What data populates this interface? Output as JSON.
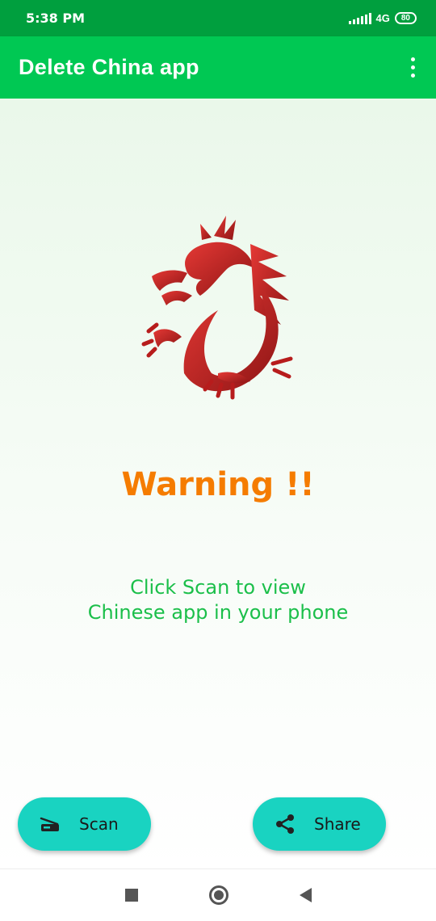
{
  "status_bar": {
    "time": "5:38 PM",
    "network": "4G",
    "battery": "80"
  },
  "app_bar": {
    "title": "Delete China app",
    "menu_icon": "more-vert-icon"
  },
  "main": {
    "image": "red-dragon-image",
    "warning": "Warning !!",
    "hint_line1": "Click Scan to view",
    "hint_line2": "Chinese app in your phone"
  },
  "actions": {
    "scan_label": "Scan",
    "scan_icon": "scanner-icon",
    "share_label": "Share",
    "share_icon": "share-icon"
  },
  "colors": {
    "status_bar": "#009f3e",
    "app_bar": "#00c853",
    "warning": "#f57c00",
    "hint": "#1bbf4a",
    "fab": "#19d3c1",
    "dragon": "#c62828"
  },
  "nav_bar": {
    "recents_icon": "recents-square-icon",
    "home_icon": "home-circle-icon",
    "back_icon": "back-triangle-icon"
  }
}
